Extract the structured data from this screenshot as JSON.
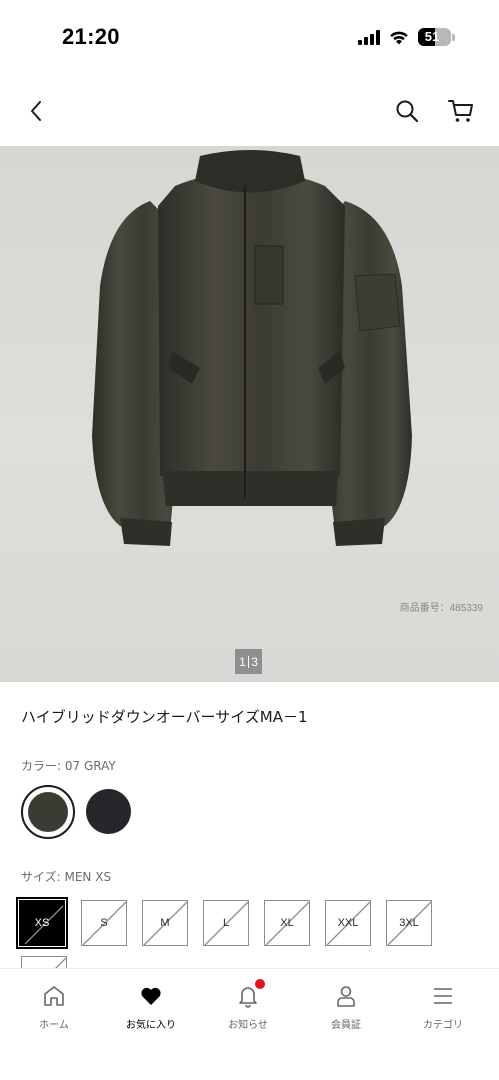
{
  "status_bar": {
    "time": "21:20",
    "battery_level": "51",
    "icons": [
      "signal-icon",
      "wifi-icon",
      "battery-icon"
    ]
  },
  "nav": {
    "icons": [
      "back-icon",
      "search-icon",
      "cart-icon"
    ]
  },
  "product": {
    "code": "商品番号：485339",
    "image_counter": {
      "current": "1",
      "total": "3"
    },
    "name": "ハイブリッドダウンオーバーサイズMA－1",
    "color_label": "カラー: 07 GRAY",
    "colors": [
      {
        "hex": "#3b3a33",
        "selected": true
      },
      {
        "hex": "#25272b",
        "selected": false
      }
    ],
    "size_label": "サイズ: MEN XS",
    "sizes": [
      {
        "label": "XS",
        "selected": true,
        "unavailable": true
      },
      {
        "label": "S",
        "selected": false,
        "unavailable": true
      },
      {
        "label": "M",
        "selected": false,
        "unavailable": true
      },
      {
        "label": "L",
        "selected": false,
        "unavailable": true
      },
      {
        "label": "XL",
        "selected": false,
        "unavailable": true
      },
      {
        "label": "XXL",
        "selected": false,
        "unavailable": true
      },
      {
        "label": "3XL",
        "selected": false,
        "unavailable": true
      },
      {
        "label": "",
        "selected": false,
        "unavailable": true
      }
    ]
  },
  "tab_bar": {
    "tabs": [
      {
        "label": "ホーム",
        "icon": "home-icon",
        "active": false
      },
      {
        "label": "お気に入り",
        "icon": "heart-icon",
        "active": true
      },
      {
        "label": "お知らせ",
        "icon": "bell-icon",
        "active": false,
        "badge": true
      },
      {
        "label": "会員証",
        "icon": "user-icon",
        "active": false
      },
      {
        "label": "カテゴリ",
        "icon": "menu-icon",
        "active": false
      }
    ]
  },
  "colors": {
    "notification_badge": "#e2131d",
    "selected_size_bg": "#000000",
    "image_background": "#dcdbd8"
  }
}
